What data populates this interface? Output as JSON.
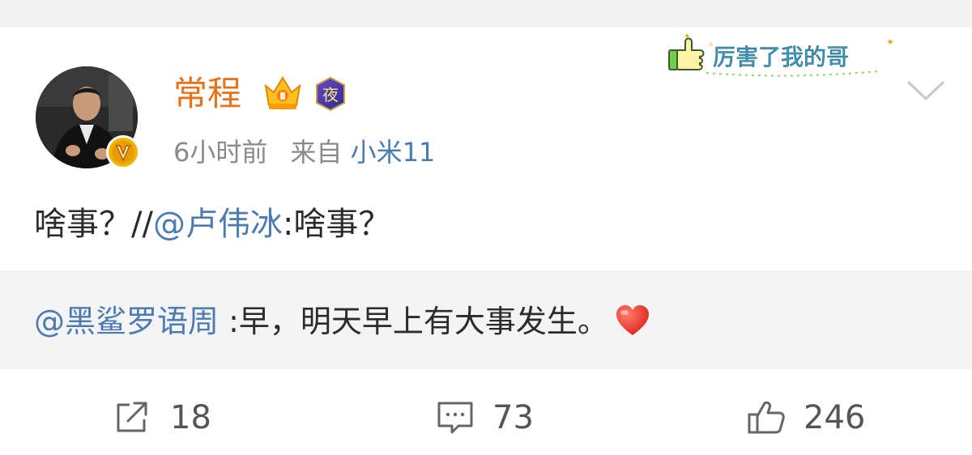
{
  "post": {
    "author": {
      "name": "常程",
      "verified_badge": "v-badge-icon",
      "crown_badge": "crown-icon",
      "night_badge_label": "夜"
    },
    "sticker_text": "厉害了我的哥",
    "meta": {
      "time": "6小时前",
      "source_prefix": "来自",
      "source": "小米11"
    },
    "text": {
      "lead": "啥事？//",
      "mention": "@卢伟冰",
      "tail": ":啥事？"
    },
    "repost": {
      "mention": "@黑鲨罗语周",
      "text": " :早，明天早上有大事发生。",
      "emoji": "heart-icon"
    },
    "actions": {
      "repost_count": "18",
      "comment_count": "73",
      "like_count": "246"
    }
  },
  "colors": {
    "username": "#e8721a",
    "link": "#4b7bb0",
    "meta": "#8a8a8a",
    "repost_bg": "#f4f4f4",
    "heart": "#e8382e"
  }
}
